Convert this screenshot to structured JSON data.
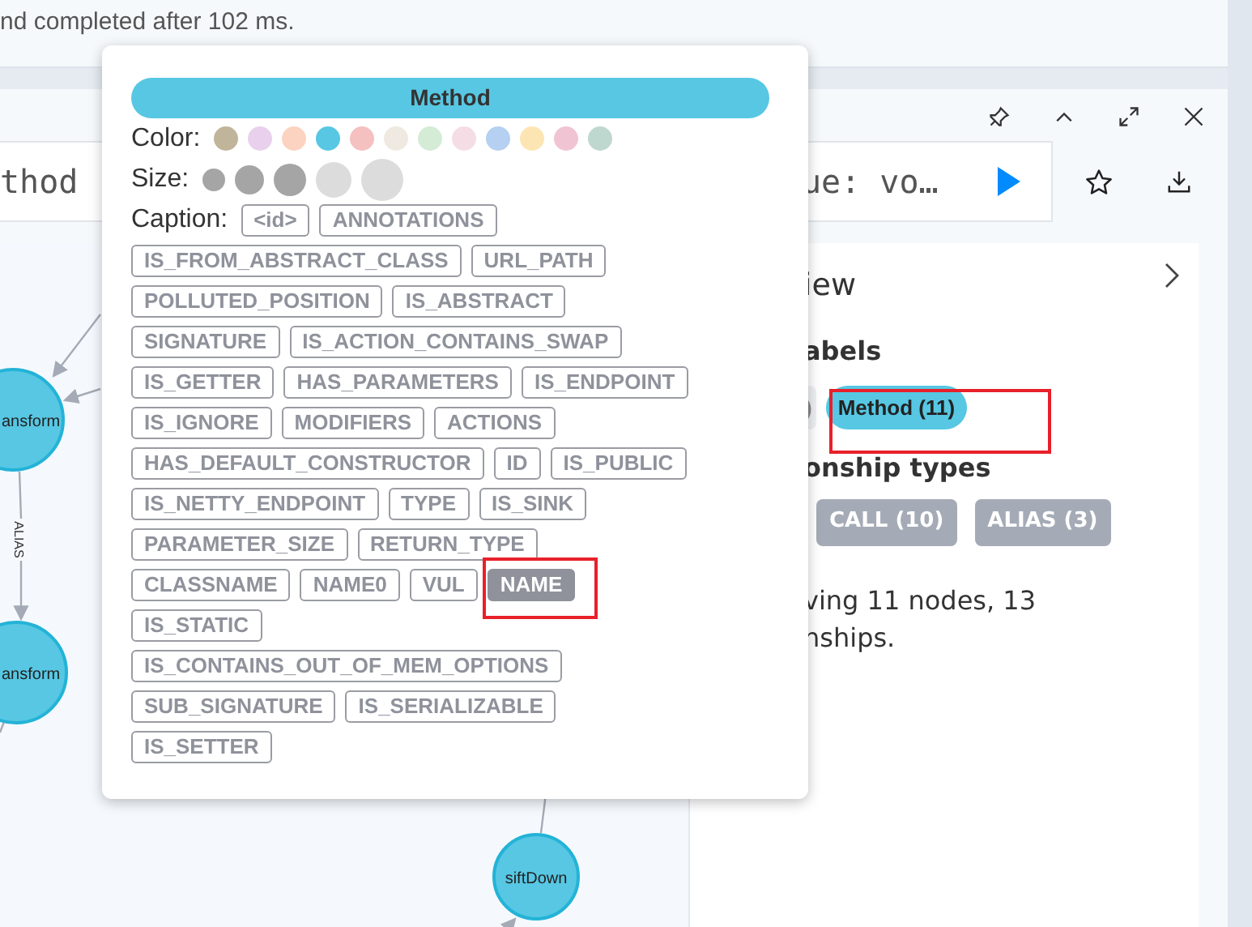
{
  "status_message": "nd completed after 102 ms.",
  "editor": {
    "text_left": "thod",
    "text_right": "ue: vo…"
  },
  "graph": {
    "nodes": [
      {
        "label": "ansform"
      },
      {
        "label": "ansform"
      },
      {
        "label": "siftDown"
      }
    ],
    "edges": [
      {
        "label": "ALIAS"
      }
    ]
  },
  "overview": {
    "title": "iew",
    "labels_heading": "abels",
    "labels": [
      {
        "text": ")",
        "selected": false
      },
      {
        "text": "Method (11)",
        "selected": true
      }
    ],
    "relationship_heading": "onship types",
    "relationships": [
      {
        "text": "CALL (10)"
      },
      {
        "text": "ALIAS (3)"
      }
    ],
    "summary_lines": [
      "ving 11 nodes, 13",
      "nships."
    ]
  },
  "popup": {
    "title": "Method",
    "color_label": "Color:",
    "colors": [
      {
        "color": "#c0b49a"
      },
      {
        "color": "#e9d0ec"
      },
      {
        "color": "#fcd3c0"
      },
      {
        "color": "#57c7e3"
      },
      {
        "color": "#f5c0c0"
      },
      {
        "color": "#efe9e1"
      },
      {
        "color": "#d4ecd6"
      },
      {
        "color": "#f5dde5"
      },
      {
        "color": "#b5d0f0"
      },
      {
        "color": "#fde5b3"
      },
      {
        "color": "#f0c4d3"
      },
      {
        "color": "#bfd8cf"
      }
    ],
    "size_label": "Size:",
    "sizes": [
      {
        "filled": true
      },
      {
        "filled": true
      },
      {
        "filled": true
      },
      {
        "filled": false
      },
      {
        "filled": false
      }
    ],
    "caption_label": "Caption:",
    "caption_rows": [
      [
        {
          "text": "<id>",
          "selected": false
        },
        {
          "text": "ANNOTATIONS",
          "selected": false
        }
      ],
      [
        {
          "text": "IS_FROM_ABSTRACT_CLASS",
          "selected": false
        },
        {
          "text": "URL_PATH",
          "selected": false
        }
      ],
      [
        {
          "text": "POLLUTED_POSITION",
          "selected": false
        },
        {
          "text": "IS_ABSTRACT",
          "selected": false
        }
      ],
      [
        {
          "text": "SIGNATURE",
          "selected": false
        },
        {
          "text": "IS_ACTION_CONTAINS_SWAP",
          "selected": false
        }
      ],
      [
        {
          "text": "IS_GETTER",
          "selected": false
        },
        {
          "text": "HAS_PARAMETERS",
          "selected": false
        },
        {
          "text": "IS_ENDPOINT",
          "selected": false
        }
      ],
      [
        {
          "text": "IS_IGNORE",
          "selected": false
        },
        {
          "text": "MODIFIERS",
          "selected": false
        },
        {
          "text": "ACTIONS",
          "selected": false
        }
      ],
      [
        {
          "text": "HAS_DEFAULT_CONSTRUCTOR",
          "selected": false
        },
        {
          "text": "ID",
          "selected": false
        },
        {
          "text": "IS_PUBLIC",
          "selected": false
        }
      ],
      [
        {
          "text": "IS_NETTY_ENDPOINT",
          "selected": false
        },
        {
          "text": "TYPE",
          "selected": false
        },
        {
          "text": "IS_SINK",
          "selected": false
        }
      ],
      [
        {
          "text": "PARAMETER_SIZE",
          "selected": false
        },
        {
          "text": "RETURN_TYPE",
          "selected": false
        }
      ],
      [
        {
          "text": "CLASSNAME",
          "selected": false
        },
        {
          "text": "NAME0",
          "selected": false
        },
        {
          "text": "VUL",
          "selected": false
        },
        {
          "text": "NAME",
          "selected": true
        }
      ],
      [
        {
          "text": "IS_STATIC",
          "selected": false
        }
      ],
      [
        {
          "text": "IS_CONTAINS_OUT_OF_MEM_OPTIONS",
          "selected": false
        }
      ],
      [
        {
          "text": "SUB_SIGNATURE",
          "selected": false
        },
        {
          "text": "IS_SERIALIZABLE",
          "selected": false
        }
      ],
      [
        {
          "text": "IS_SETTER",
          "selected": false
        }
      ]
    ]
  }
}
